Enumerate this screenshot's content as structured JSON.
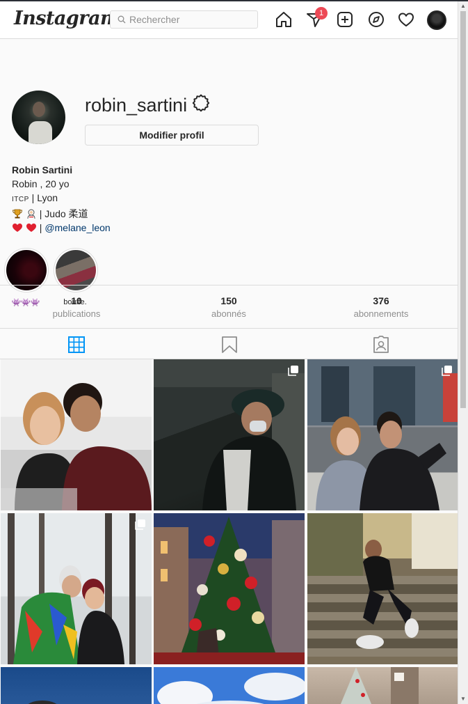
{
  "header": {
    "logo": "Instagram",
    "search_placeholder": "Rechercher",
    "notification_count": "1",
    "icons": [
      "home-icon",
      "direct-icon",
      "new-post-icon",
      "explore-icon",
      "activity-icon",
      "profile-avatar"
    ]
  },
  "profile": {
    "username": "robin_sartini",
    "edit_label": "Modifier profil",
    "full_name": "Robin Sartini",
    "bio_line1": "Robin , 20 yo",
    "bio_line2_small": "ITCP",
    "bio_line2_rest": " | Lyon",
    "bio_line3_text": " | Judo 柔道",
    "bio_line4_sep": " | ",
    "bio_line4_link": "@melane_leon"
  },
  "highlights": [
    {
      "label": "👾👾👾"
    },
    {
      "label": "bouffe."
    }
  ],
  "stats": [
    {
      "value": "10",
      "label": "publications"
    },
    {
      "value": "150",
      "label": "abonnés"
    },
    {
      "value": "376",
      "label": "abonnements"
    }
  ],
  "tabs": [
    "grid-icon",
    "saved-icon",
    "tagged-icon"
  ],
  "colors": {
    "accent": "#0095f6",
    "badge": "#ed4956",
    "link": "#00376b"
  }
}
